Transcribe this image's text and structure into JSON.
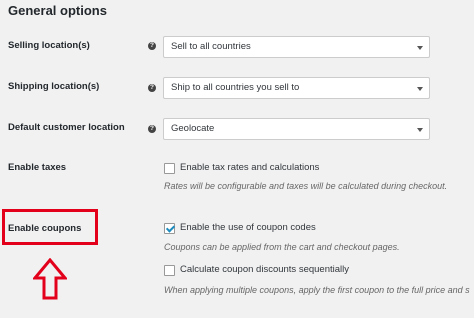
{
  "section": {
    "title": "General options"
  },
  "fields": {
    "selling": {
      "label": "Selling location(s)",
      "value": "Sell to all countries"
    },
    "shipping": {
      "label": "Shipping location(s)",
      "value": "Ship to all countries you sell to"
    },
    "customer_location": {
      "label": "Default customer location",
      "value": "Geolocate"
    },
    "taxes": {
      "label": "Enable taxes",
      "checkbox_label": "Enable tax rates and calculations",
      "checked": false,
      "description": "Rates will be configurable and taxes will be calculated during checkout."
    },
    "coupons": {
      "label": "Enable coupons",
      "checkbox_label": "Enable the use of coupon codes",
      "checked": true,
      "description": "Coupons can be applied from the cart and checkout pages.",
      "sequential": {
        "checkbox_label": "Calculate coupon discounts sequentially",
        "checked": false,
        "description": "When applying multiple coupons, apply the first coupon to the full price and s"
      }
    }
  },
  "icons": {
    "help": "?",
    "help_icon_name": "help-icon",
    "dropdown_icon_name": "chevron-down-icon",
    "arrow_icon_name": "arrow-up-icon"
  },
  "colors": {
    "background": "#f1f1f1",
    "highlight": "#e2001a",
    "checkmark": "#1e8cbe"
  }
}
